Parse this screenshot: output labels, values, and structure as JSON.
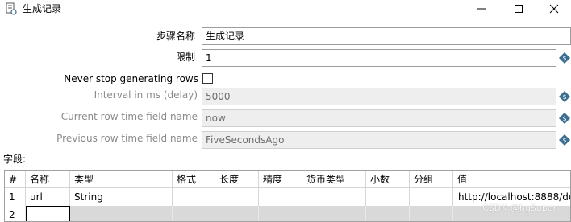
{
  "window": {
    "title": "生成记录"
  },
  "form": {
    "step_name": {
      "label": "步骤名称",
      "value": "生成记录"
    },
    "limit": {
      "label": "限制",
      "value": "1"
    },
    "never_stop": {
      "label": "Never stop generating rows",
      "checked": false
    },
    "interval": {
      "label": "Interval in ms (delay)",
      "value": "5000"
    },
    "current_time_field": {
      "label": "Current row time field name",
      "value": "now"
    },
    "previous_time_field": {
      "label": "Previous row time field name",
      "value": "FiveSecondsAgo"
    }
  },
  "fields_section": {
    "label": "字段:"
  },
  "table": {
    "headers": [
      "#",
      "名称",
      "类型",
      "格式",
      "长度",
      "精度",
      "货币类型",
      "小数",
      "分组",
      "值"
    ],
    "rows": [
      [
        "1",
        "url",
        "String",
        "",
        "",
        "",
        "",
        "",
        "",
        "http://localhost:8888/de"
      ],
      [
        "2",
        "",
        "",
        "",
        "",
        "",
        "",
        "",
        "",
        ""
      ]
    ]
  },
  "watermark": "CSDN @hgSuper",
  "colors": {
    "variable_icon": "#3b6e8f",
    "disabled_bg": "#eeeeee",
    "row_highlight": "#d9d9d9"
  }
}
